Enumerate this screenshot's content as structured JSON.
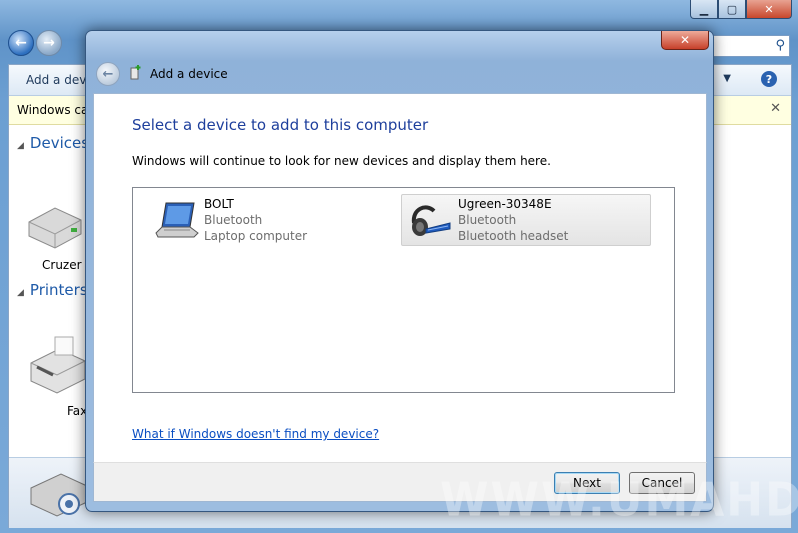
{
  "background_window": {
    "toolbar_label": "Add a devic",
    "infobar_text": "Windows can",
    "sections": [
      {
        "label": "Devices"
      },
      {
        "label": "Printers a"
      }
    ],
    "device_labels": [
      "Cruzer B",
      "Fax"
    ]
  },
  "dialog": {
    "title": "Add a device",
    "close_symbol": "✕",
    "heading": "Select a device to add to this computer",
    "description": "Windows will continue to look for new devices and display them here.",
    "devices": [
      {
        "name": "BOLT",
        "connection": "Bluetooth",
        "type": "Laptop computer",
        "icon": "laptop-icon",
        "selected": false
      },
      {
        "name": "Ugreen-30348E",
        "connection": "Bluetooth",
        "type": "Bluetooth headset",
        "icon": "headset-icon",
        "selected": true
      }
    ],
    "help_link": "What if Windows doesn't find my device?",
    "buttons": {
      "next": "Next",
      "cancel": "Cancel"
    }
  },
  "watermark": "WWW.UMAHDROID.COM",
  "colors": {
    "heading": "#1e3f9c",
    "link": "#0a4ec2",
    "infobar": "#ffffe1",
    "frame": "#9dbde0"
  }
}
